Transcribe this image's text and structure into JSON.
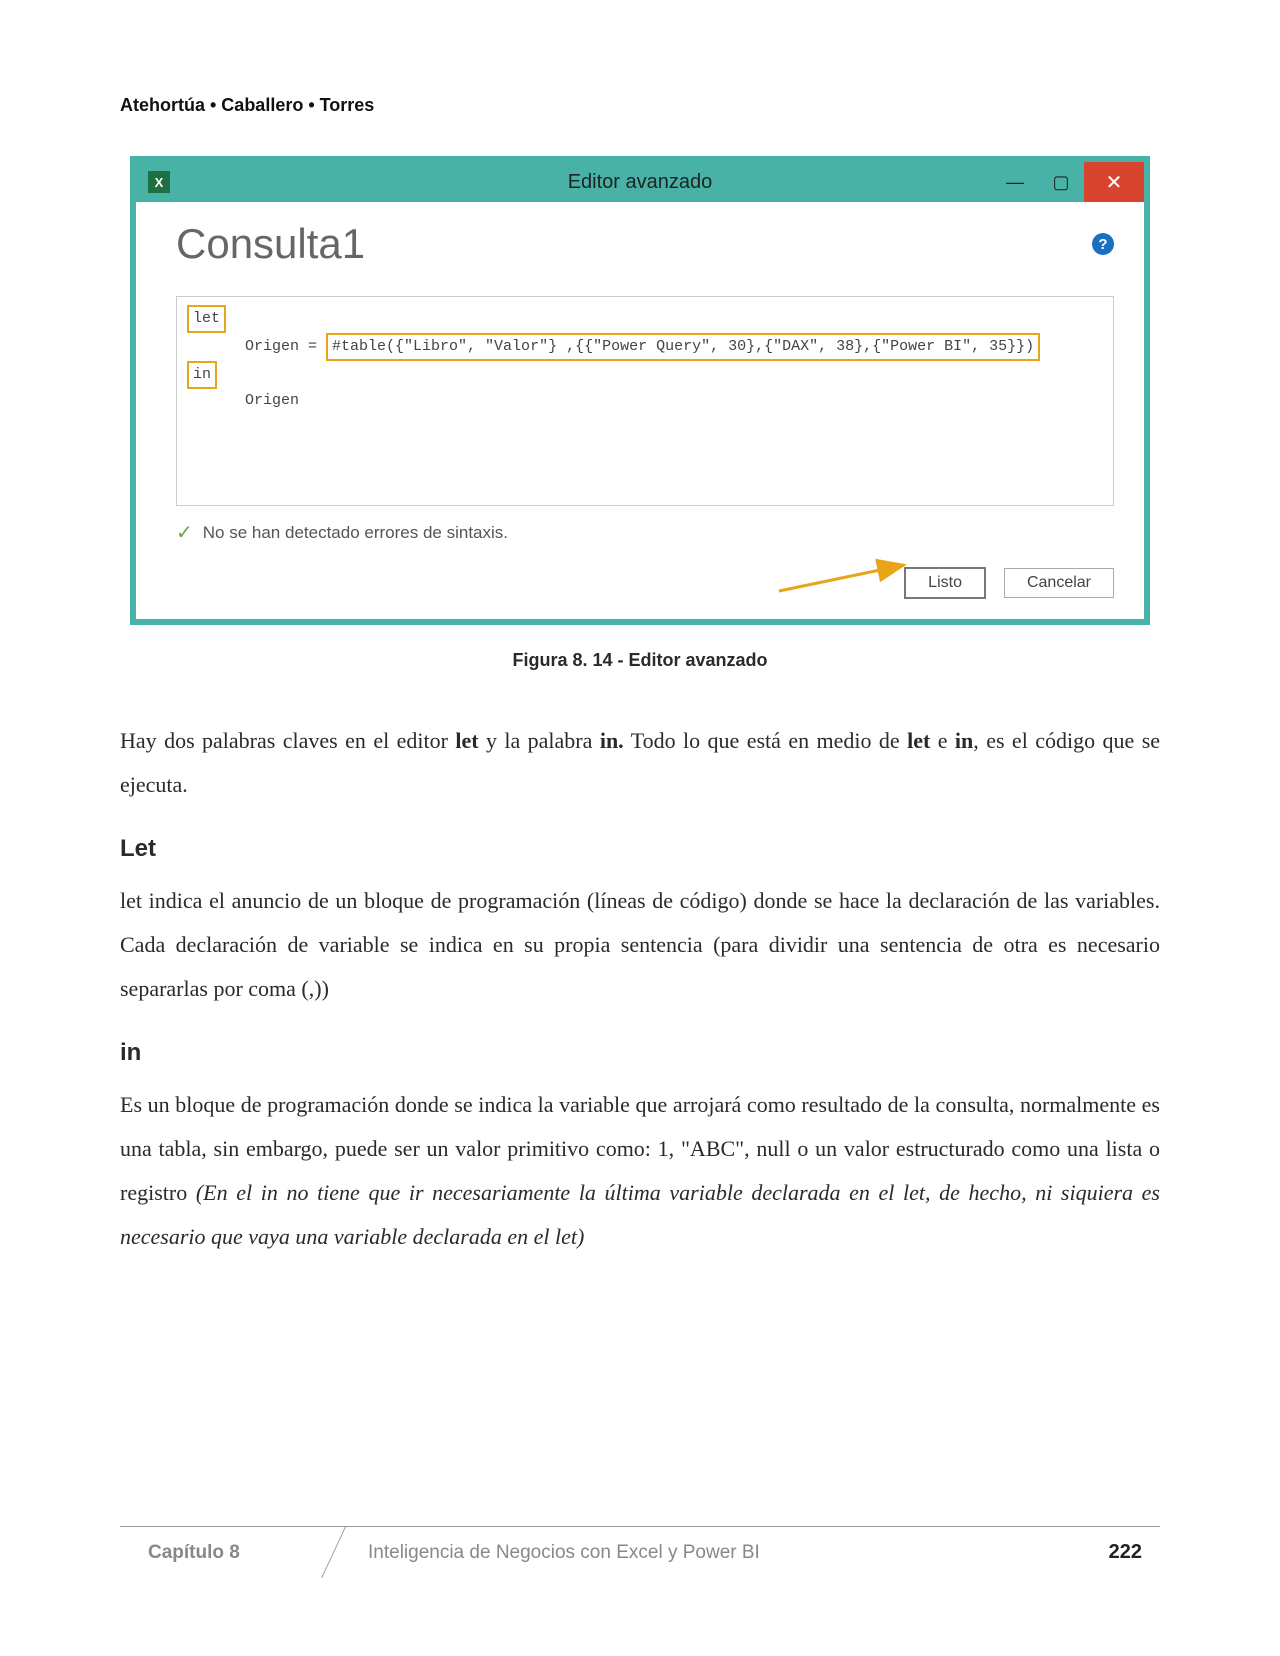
{
  "header": {
    "authors": "Atehortúa • Caballero • Torres"
  },
  "editor": {
    "excel_icon": "X",
    "title": "Editor avanzado",
    "min": "—",
    "max": "▢",
    "close": "✕",
    "query_title": "Consulta1",
    "help": "?",
    "code": {
      "let": "let",
      "origen_label": "Origen =",
      "table_expr": "#table({\"Libro\",  \"Valor\"} ,{{\"Power Query\", 30},{\"DAX\", 38},{\"Power BI\", 35}})",
      "in": "in",
      "origen_ret": "Origen"
    },
    "status": "No se han detectado errores de sintaxis.",
    "listo": "Listo",
    "cancelar": "Cancelar"
  },
  "figure_caption": "Figura 8. 14 - Editor avanzado",
  "body": {
    "p1_a": "Hay dos palabras claves en el editor ",
    "p1_let": "let",
    "p1_b": " y la palabra ",
    "p1_in": "in.",
    "p1_c": " Todo lo que está en medio de ",
    "p1_let2": "let",
    "p1_d": " e ",
    "p1_in2": "in",
    "p1_e": ", es el código que se ejecuta.",
    "h_let": "Let",
    "p2": "let indica el anuncio de un bloque de programación (líneas de código) donde se hace la declaración de las variables. Cada declaración de variable se indica en su propia sentencia (para dividir una sentencia de otra es necesario separarlas por coma (,))",
    "h_in": "in",
    "p3_a": "Es un bloque de programación donde se indica la variable que arrojará como resultado de la consulta, normalmente es una tabla, sin embargo, puede ser un valor primitivo como: 1, \"ABC\", null o un valor estructurado como una lista o registro ",
    "p3_i": "(En el in no tiene que ir necesariamente la última variable declarada en el let, de hecho, ni siquiera es necesario que vaya una variable declarada en el let)"
  },
  "footer": {
    "chapter": "Capítulo 8",
    "book": "Inteligencia de Negocios con Excel y Power BI",
    "page": "222"
  }
}
